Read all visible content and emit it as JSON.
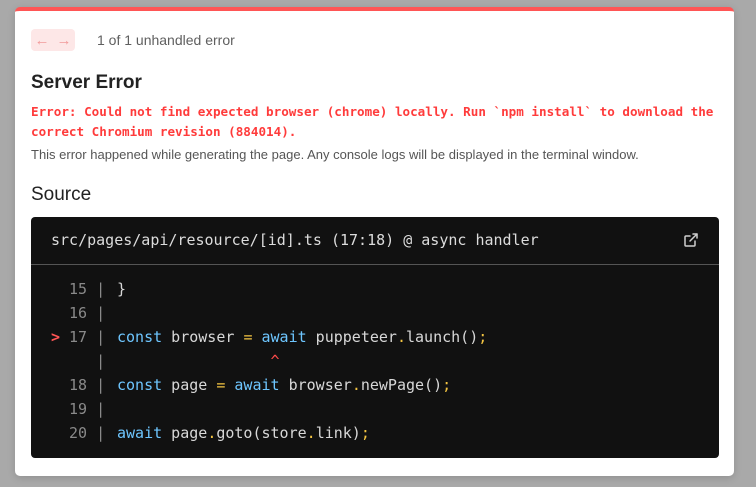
{
  "nav": {
    "prev_icon": "←",
    "next_icon": "→",
    "label": "1 of 1 unhandled error"
  },
  "title": "Server Error",
  "error_message": "Error: Could not find expected browser (chrome) locally. Run `npm install` to download the correct Chromium revision (884014).",
  "hint": "This error happened while generating the page. Any console logs will be displayed in the terminal window.",
  "source": {
    "heading": "Source",
    "file_location": "src/pages/api/resource/[id].ts (17:18) @ async handler",
    "open_icon": "external-link-icon",
    "lines": [
      {
        "marker": "",
        "gutter": "15 |",
        "tokens": [
          {
            "t": "}",
            "c": ""
          }
        ]
      },
      {
        "marker": "",
        "gutter": "16 |",
        "tokens": []
      },
      {
        "marker": ">",
        "gutter": "17 |",
        "tokens": [
          {
            "t": "const",
            "c": "kw"
          },
          {
            "t": " browser ",
            "c": ""
          },
          {
            "t": "=",
            "c": "op"
          },
          {
            "t": " ",
            "c": ""
          },
          {
            "t": "await",
            "c": "kw"
          },
          {
            "t": " puppeteer",
            "c": ""
          },
          {
            "t": ".",
            "c": "op"
          },
          {
            "t": "launch()",
            "c": ""
          },
          {
            "t": ";",
            "c": "op"
          }
        ]
      },
      {
        "marker": "",
        "gutter": "   |",
        "tokens": [
          {
            "t": "                 ^",
            "c": "caret"
          }
        ]
      },
      {
        "marker": "",
        "gutter": "18 |",
        "tokens": [
          {
            "t": "const",
            "c": "kw"
          },
          {
            "t": " page ",
            "c": ""
          },
          {
            "t": "=",
            "c": "op"
          },
          {
            "t": " ",
            "c": ""
          },
          {
            "t": "await",
            "c": "kw"
          },
          {
            "t": " browser",
            "c": ""
          },
          {
            "t": ".",
            "c": "op"
          },
          {
            "t": "newPage()",
            "c": ""
          },
          {
            "t": ";",
            "c": "op"
          }
        ]
      },
      {
        "marker": "",
        "gutter": "19 |",
        "tokens": []
      },
      {
        "marker": "",
        "gutter": "20 |",
        "tokens": [
          {
            "t": "await",
            "c": "kw"
          },
          {
            "t": " page",
            "c": ""
          },
          {
            "t": ".",
            "c": "op"
          },
          {
            "t": "goto(store",
            "c": ""
          },
          {
            "t": ".",
            "c": "op"
          },
          {
            "t": "link)",
            "c": ""
          },
          {
            "t": ";",
            "c": "op"
          }
        ]
      }
    ]
  },
  "colors": {
    "accent": "#ff5555",
    "code_bg": "#111111",
    "keyword": "#6ec6ff",
    "operator": "#f4c542"
  }
}
